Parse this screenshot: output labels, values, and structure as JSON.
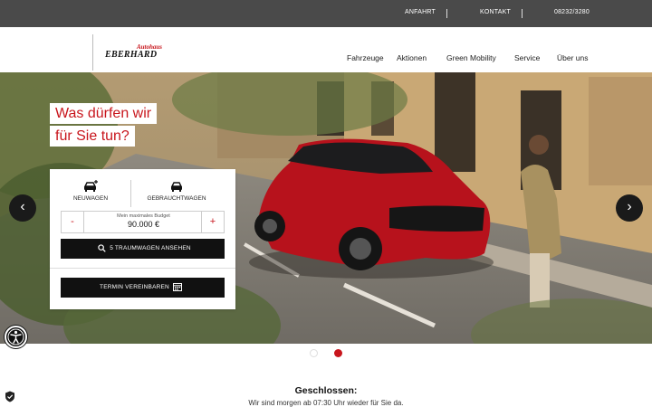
{
  "topbar": {
    "anfahrt": "ANFAHRT",
    "kontakt": "KONTAKT",
    "phone": "08232/3280"
  },
  "logo": {
    "line1": "Autohaus",
    "line2": "EBERHARD"
  },
  "nav": {
    "items": [
      "Fahrzeuge",
      "Aktionen",
      "Green Mobility",
      "Service",
      "Über uns"
    ]
  },
  "hero": {
    "headline_line1": "Was dürfen wir",
    "headline_line2": "für Sie tun?"
  },
  "search_card": {
    "tab_new": "NEUWAGEN",
    "tab_used": "GEBRAUCHTWAGEN",
    "budget_label": "Mein maximales Budget",
    "budget_value": "90.000 €",
    "minus": "-",
    "plus": "+",
    "search_button": "5 TRAUMWAGEN ANSEHEN",
    "appointment_button": "TERMIN VEREINBAREN"
  },
  "slider": {
    "prev": "‹",
    "next": "›",
    "active_slide": 2,
    "slide_count": 2
  },
  "status": {
    "title": "Geschlossen:",
    "text": "Wir sind morgen ab 07:30 Uhr wieder für Sie da."
  },
  "colors": {
    "brand_red": "#c8161d",
    "topbar": "#4a4a4a",
    "button": "#111111"
  },
  "icons": {
    "new_car": "car-plus-icon",
    "used_car": "car-icon",
    "search": "search-icon",
    "calendar": "calendar-icon",
    "accessibility": "accessibility-icon",
    "privacy": "shield-icon"
  }
}
